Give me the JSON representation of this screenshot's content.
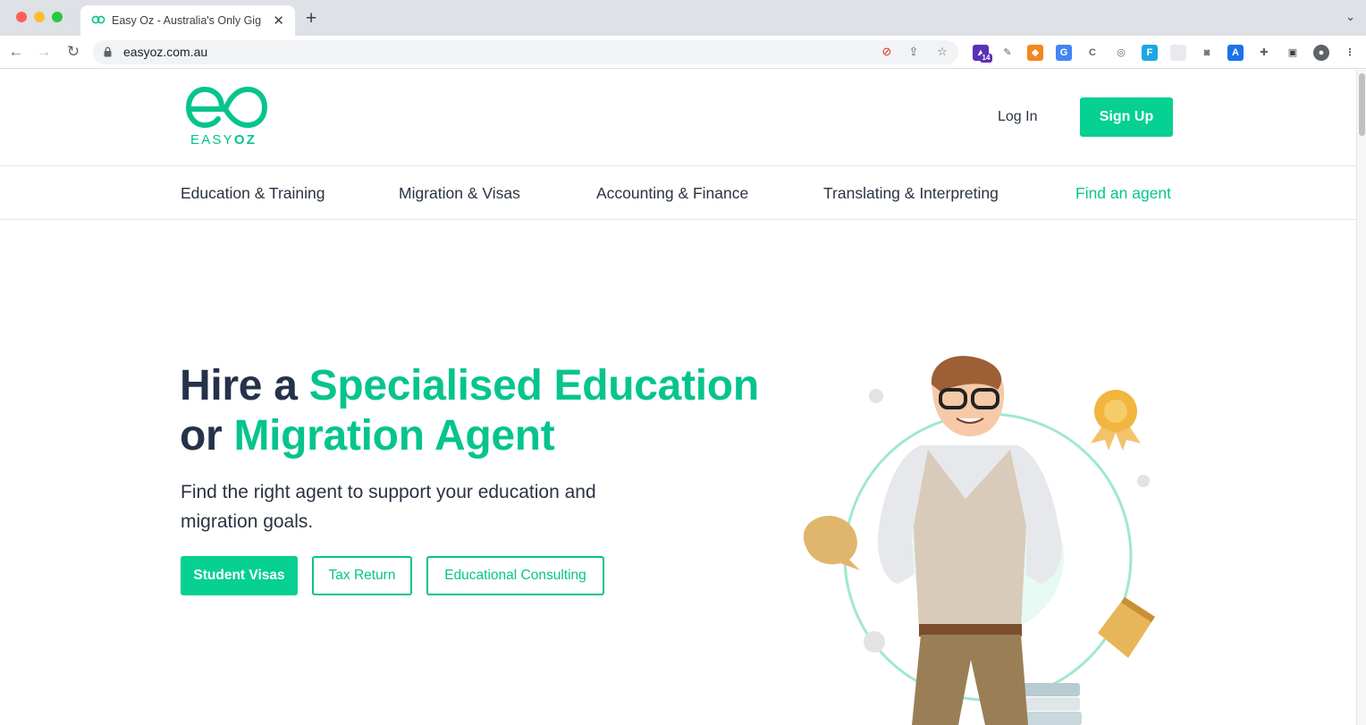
{
  "browser": {
    "tab_title": "Easy Oz - Australia's Only Gig",
    "url": "easyoz.com.au",
    "extension_badge": "14"
  },
  "header": {
    "logo_text_light": "EASY",
    "logo_text_bold": "OZ",
    "login_label": "Log In",
    "signup_label": "Sign Up"
  },
  "nav": {
    "items": [
      {
        "label": "Education & Training"
      },
      {
        "label": "Migration & Visas"
      },
      {
        "label": "Accounting & Finance"
      },
      {
        "label": "Translating & Interpreting"
      },
      {
        "label": "Find an agent"
      }
    ]
  },
  "hero": {
    "title_part1": "Hire a ",
    "title_highlight1": "Specialised Education",
    "title_part2": "or ",
    "title_highlight2": "Migration Agent",
    "subtitle": "Find the right agent to support your education and migration goals.",
    "buttons": [
      {
        "label": "Student Visas"
      },
      {
        "label": "Tax Return"
      },
      {
        "label": "Educational Consulting"
      }
    ]
  },
  "colors": {
    "accent": "#06d092",
    "text_dark": "#25324a"
  }
}
